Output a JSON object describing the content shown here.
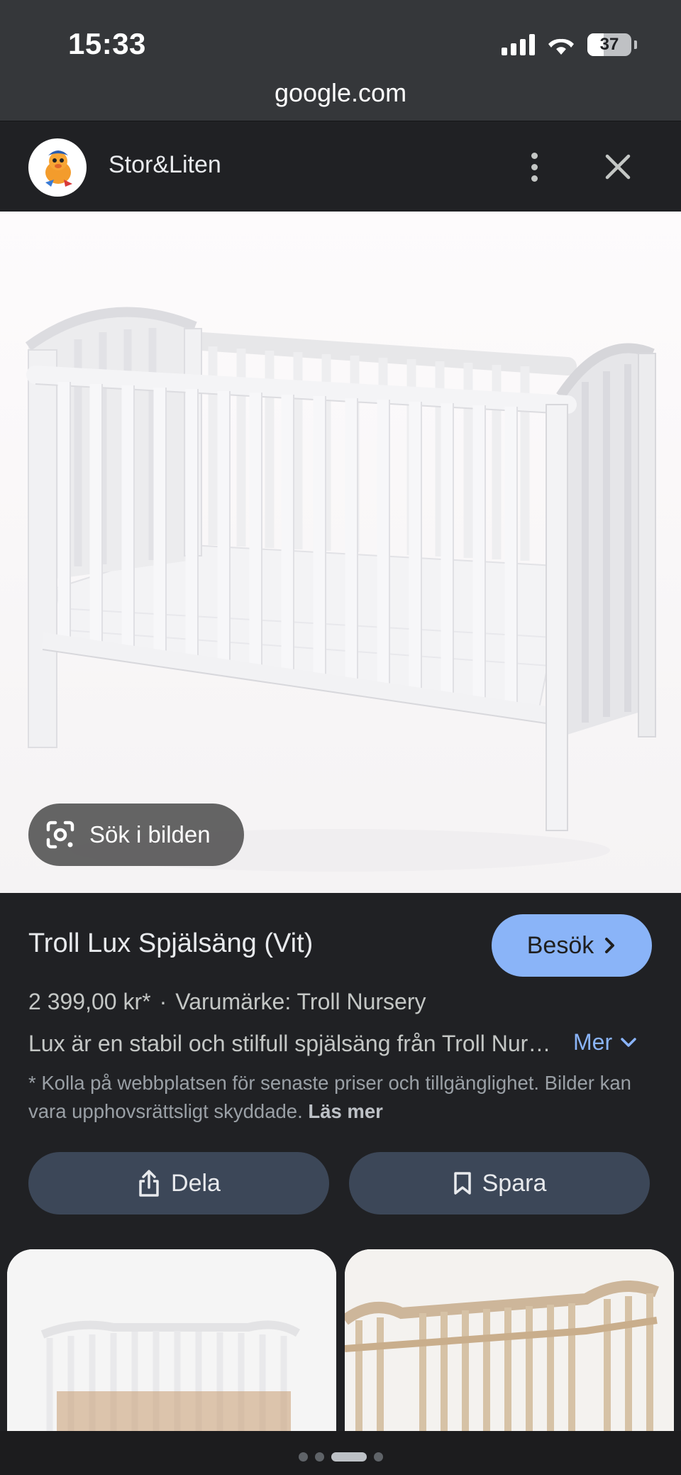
{
  "status_bar": {
    "time": "15:33",
    "battery": "37",
    "battery_level": 0.37,
    "icons": [
      "signal-icon",
      "wifi-icon",
      "battery-icon"
    ]
  },
  "browser": {
    "url": "google.com"
  },
  "source": {
    "name": "Stor&Liten",
    "icons": [
      "more-vert-icon",
      "close-icon"
    ]
  },
  "image_area": {
    "lens_label": "Sök i bilden",
    "lens_icon": "google-lens-icon"
  },
  "product": {
    "title": "Troll Lux Spjälsäng (Vit)",
    "visit_label": "Besök",
    "price": "2 399,00 kr*",
    "separator": "·",
    "brand": "Varumärke: Troll Nursery",
    "description": "Lux är en stabil och stilfull spjälsäng från Troll Nursery",
    "more_label": "Mer",
    "disclaimer": "* Kolla på webbplatsen för senaste priser och tillgänglighet. Bilder kan vara upphovsrättsligt skyddade.",
    "read_more_label": "Läs mer"
  },
  "actions": {
    "share_label": "Dela",
    "save_label": "Spara"
  },
  "pager": {
    "count": 4,
    "active_index": 2
  },
  "colors": {
    "background": "#202124",
    "accent_blue": "#8ab4f8",
    "action_button": "#3c4758",
    "status_bar": "#35373a"
  }
}
